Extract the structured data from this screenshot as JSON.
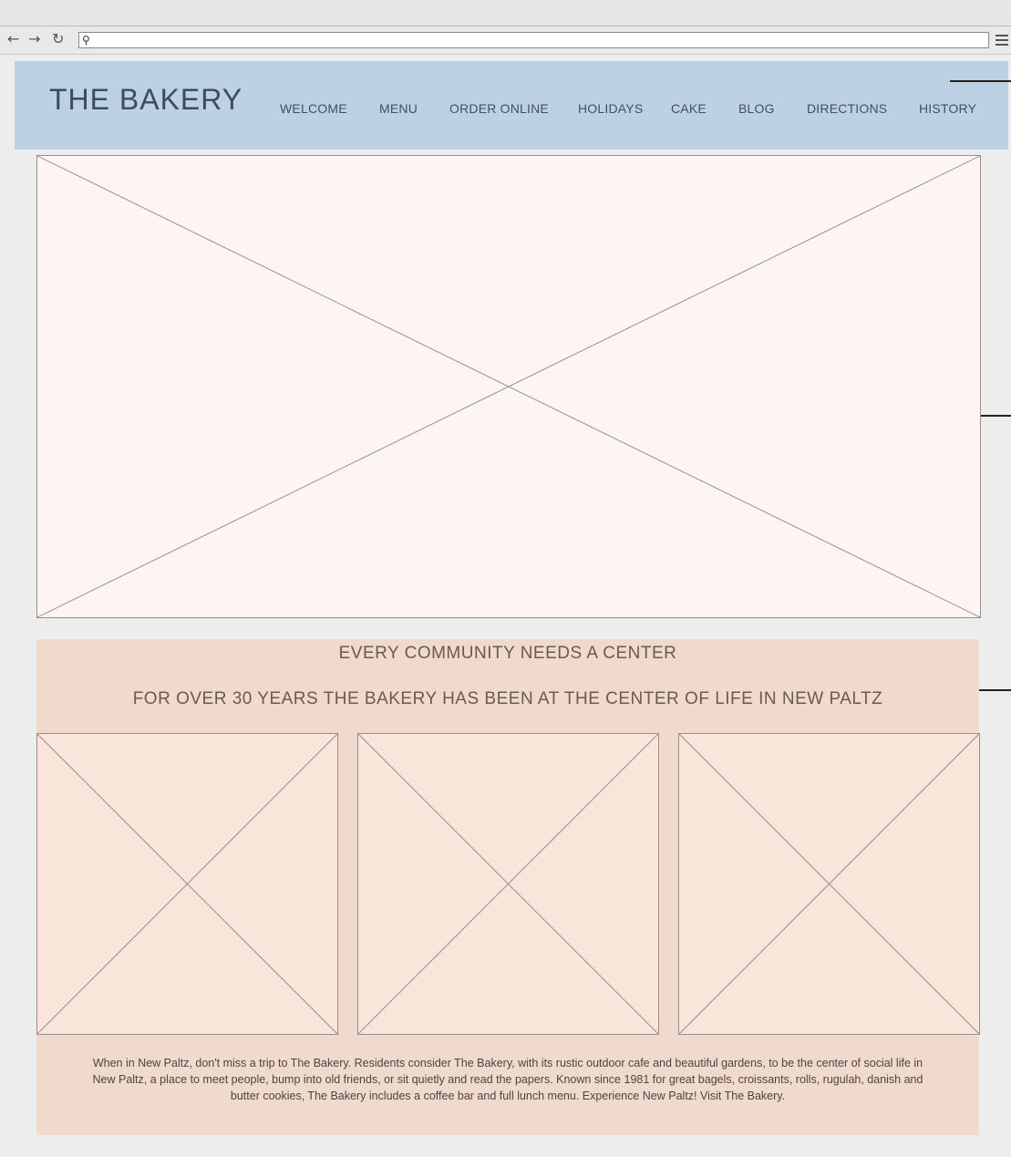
{
  "browser": {
    "back_icon": "back-arrow-icon",
    "forward_icon": "forward-arrow-icon",
    "reload_icon": "reload-icon",
    "search_icon": "search-icon",
    "menu_icon": "hamburger-menu-icon",
    "back_glyph": "←",
    "forward_glyph": "→",
    "reload_glyph": "↻",
    "search_glyph": "⚲",
    "address_value": ""
  },
  "header": {
    "logo": "THE BAKERY",
    "nav": [
      "WELCOME",
      "MENU",
      "ORDER ONLINE",
      "HOLIDAYS",
      "CAKE",
      "BLOG",
      "DIRECTIONS",
      "HISTORY"
    ]
  },
  "community": {
    "heading": "EVERY COMMUNITY NEEDS A CENTER",
    "subheading": "FOR OVER 30 YEARS THE BAKERY HAS BEEN AT THE CENTER OF LIFE IN NEW PALTZ",
    "blurb": "When in New Paltz, don't miss a trip to The Bakery. Residents consider The Bakery, with its rustic outdoor cafe and beautiful gardens, to be the center of social life in New Paltz,  a place to meet people, bump into old friends, or sit quietly and read the papers. Known since 1981 for great bagels, croissants, rolls, rugulah, danish and butter cookies, The Bakery includes a coffee bar and full lunch menu. Experience New Paltz! Visit The Bakery."
  },
  "colors": {
    "header_bg": "#bdd1e5",
    "hero_bg": "#fdf5f2",
    "section_bg": "#f0dacd",
    "thumb_bg": "#f9e5da",
    "placeholder_line": "#9a8f8f"
  }
}
